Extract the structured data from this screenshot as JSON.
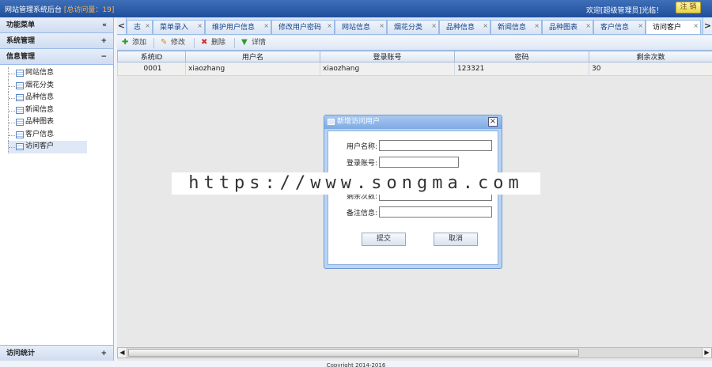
{
  "topbar": {
    "title": "网站管理系统后台",
    "visit_count": "[总访问量：19]",
    "welcome": "欢迎[超级管理员]光临！",
    "logout": "注 销"
  },
  "sidebar": {
    "menu_title": "功能菜单",
    "collapse": "«",
    "sections": [
      {
        "label": "系统管理",
        "tool": "+"
      },
      {
        "label": "信息管理",
        "tool": "−"
      }
    ],
    "items": [
      {
        "label": "网站信息"
      },
      {
        "label": "烟花分类"
      },
      {
        "label": "品种信息"
      },
      {
        "label": "新闻信息"
      },
      {
        "label": "品种图表"
      },
      {
        "label": "客户信息"
      },
      {
        "label": "访问客户"
      }
    ],
    "footer": {
      "label": "访问统计",
      "tool": "+"
    }
  },
  "tabs": {
    "prev": "<",
    "next": ">",
    "items": [
      {
        "label": "志"
      },
      {
        "label": "菜单录入"
      },
      {
        "label": "维护用户信息"
      },
      {
        "label": "修改用户密码"
      },
      {
        "label": "网站信息"
      },
      {
        "label": "烟花分类"
      },
      {
        "label": "品种信息"
      },
      {
        "label": "新闻信息"
      },
      {
        "label": "品种图表"
      },
      {
        "label": "客户信息"
      },
      {
        "label": "访问客户"
      }
    ],
    "close_glyph": "×"
  },
  "toolbar": {
    "add": "添加",
    "edit": "修改",
    "delete": "删除",
    "detail": "详情"
  },
  "grid": {
    "columns": [
      "系统ID",
      "用户名",
      "登录账号",
      "密码",
      "剩余次数"
    ],
    "rows": [
      [
        "0001",
        "xiaozhang",
        "xiaozhang",
        "123321",
        "30"
      ]
    ]
  },
  "dialog": {
    "title": "新增访问用户",
    "close": "×",
    "fields": [
      {
        "label": "用户名称:",
        "value": ""
      },
      {
        "label": "登录账号:",
        "value": ""
      },
      {
        "label": "剩余次数:",
        "value": ""
      },
      {
        "label": "备注信息:",
        "value": ""
      }
    ],
    "submit": "提交",
    "cancel": "取消"
  },
  "watermark": "https://www.songma.com",
  "footer": "Copyright 2014-2016"
}
